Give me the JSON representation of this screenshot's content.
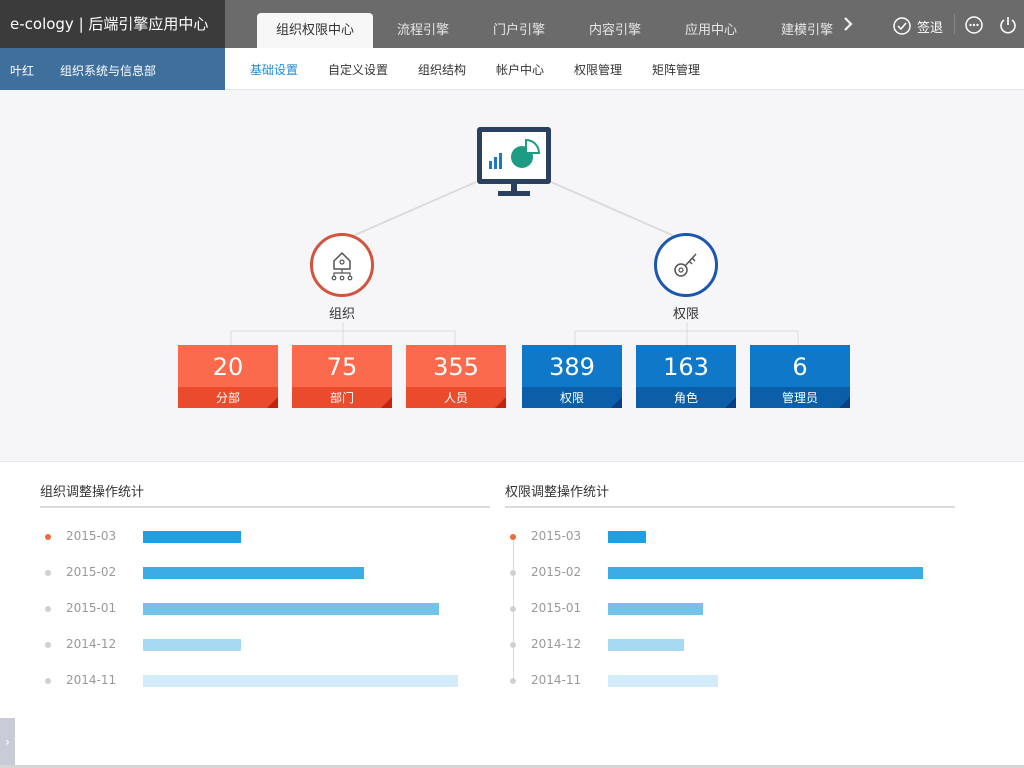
{
  "header": {
    "brand": "e-cology | 后端引擎应用中心",
    "tabs": [
      {
        "label": "组织权限中心",
        "active": true
      },
      {
        "label": "流程引擎"
      },
      {
        "label": "门户引擎"
      },
      {
        "label": "内容引擎"
      },
      {
        "label": "应用中心"
      },
      {
        "label": "建模引擎"
      }
    ],
    "signout_label": "签退"
  },
  "user": {
    "name": "叶红",
    "department": "组织系统与信息部"
  },
  "subnav": [
    {
      "label": "基础设置",
      "active": true
    },
    {
      "label": "自定义设置"
    },
    {
      "label": "组织结构"
    },
    {
      "label": "帐户中心"
    },
    {
      "label": "权限管理"
    },
    {
      "label": "矩阵管理"
    }
  ],
  "overview": {
    "org": {
      "label": "组织",
      "cards": [
        {
          "value": "20",
          "label": "分部"
        },
        {
          "value": "75",
          "label": "部门"
        },
        {
          "value": "355",
          "label": "人员"
        }
      ]
    },
    "perm": {
      "label": "权限",
      "cards": [
        {
          "value": "389",
          "label": "权限"
        },
        {
          "value": "163",
          "label": "角色"
        },
        {
          "value": "6",
          "label": "管理员"
        }
      ]
    }
  },
  "stats": {
    "org": {
      "title": "组织调整操作统计",
      "rows": [
        {
          "date": "2015-03",
          "level": 0.31,
          "current": true
        },
        {
          "date": "2015-02",
          "level": 0.7
        },
        {
          "date": "2015-01",
          "level": 0.94
        },
        {
          "date": "2014-12",
          "level": 0.31
        },
        {
          "date": "2014-11",
          "level": 1.0
        }
      ]
    },
    "perm": {
      "title": "权限调整操作统计",
      "rows": [
        {
          "date": "2015-03",
          "level": 0.12,
          "current": true
        },
        {
          "date": "2015-02",
          "level": 1.0
        },
        {
          "date": "2015-01",
          "level": 0.3
        },
        {
          "date": "2014-12",
          "level": 0.24
        },
        {
          "date": "2014-11",
          "level": 0.35
        }
      ]
    },
    "bar_colors": [
      "#1ea0e4",
      "#3cace6",
      "#72c2ea",
      "#a8d9f2",
      "#d4ecf9"
    ]
  },
  "colors": {
    "header_bg": "#6b6b6b",
    "brand_bg": "#3b3b3b",
    "user_bg": "#3e6f9d",
    "accent": "#1f8ad6",
    "org_accent": "#fb6a4c",
    "perm_accent": "#0f78c8"
  }
}
